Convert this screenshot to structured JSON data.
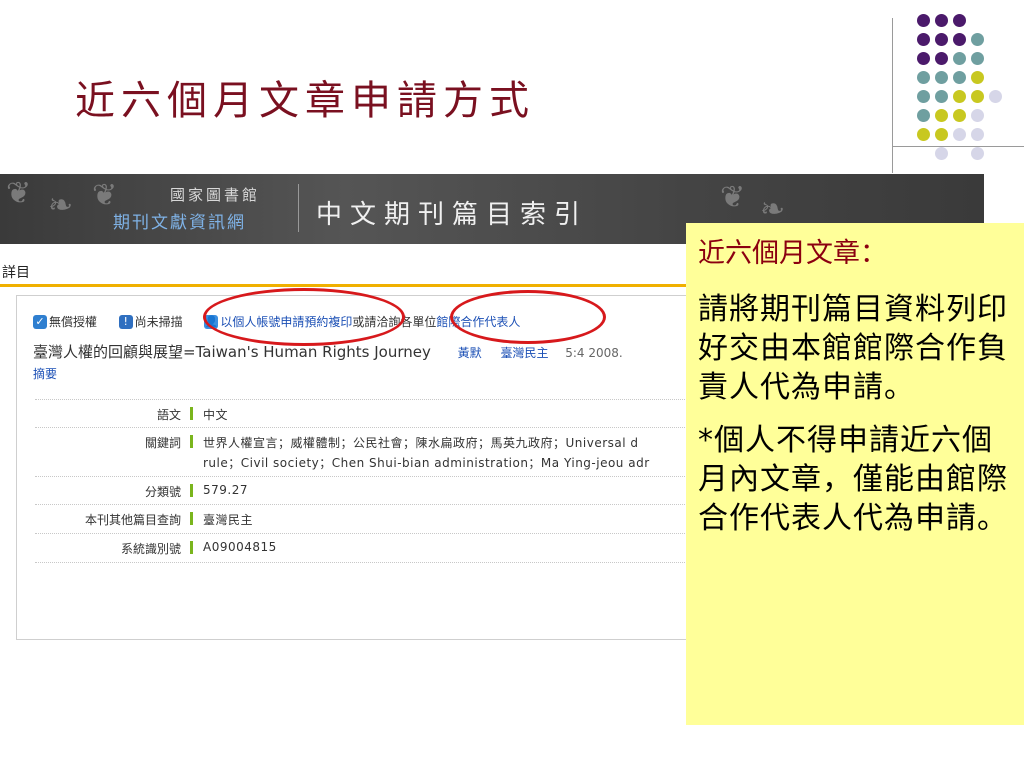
{
  "slide": {
    "title": "近六個月文章申請方式"
  },
  "decor": {
    "dot_colors": {
      "purple": "#4b1a6b",
      "teal": "#6f9fa0",
      "lime": "#c8c820",
      "lilac": "#d6d6e8"
    }
  },
  "header": {
    "org_line1": "國家圖書館",
    "org_line2": "期刊文獻資訊網",
    "system_title": "中文期刊篇目索引"
  },
  "page": {
    "section_label": "詳目"
  },
  "actions": {
    "no_license": "無償授權",
    "not_scanned": "尚未掃描",
    "apply_prefix": "以個人帳號申請預約複印",
    "apply_middle": "或請洽詢各單位",
    "ill_link": "館際合作代表人"
  },
  "article": {
    "title": "臺灣人權的回顧與展望=Taiwan's Human Rights Journey",
    "author": "黃默",
    "journal": "臺灣民主",
    "meta": "5:4 2008.",
    "abstract_link": "摘要"
  },
  "details": {
    "rows": [
      {
        "label": "語文",
        "value": "中文"
      },
      {
        "label": "關鍵詞",
        "value": "世界人權宣言；威權體制；公民社會；陳水扁政府；馬英九政府；Universal d",
        "value2": "rule；Civil society；Chen Shui-bian administration；Ma Ying-jeou adr"
      },
      {
        "label": "分類號",
        "value": "579.27"
      },
      {
        "label": "本刊其他篇目查詢",
        "value": "臺灣民主"
      },
      {
        "label": "系統識別號",
        "value": "A09004815"
      }
    ]
  },
  "callout": {
    "heading": "近六個月文章：",
    "para1": "請將期刊篇目資料列印好交由本館館際合作負責人代為申請。",
    "para2": "*個人不得申請近六個月內文章，僅能由館際合作代表人代為申請。",
    "bg_color": "#ffff99"
  },
  "annotation": {
    "oval_color": "#d7191c"
  }
}
